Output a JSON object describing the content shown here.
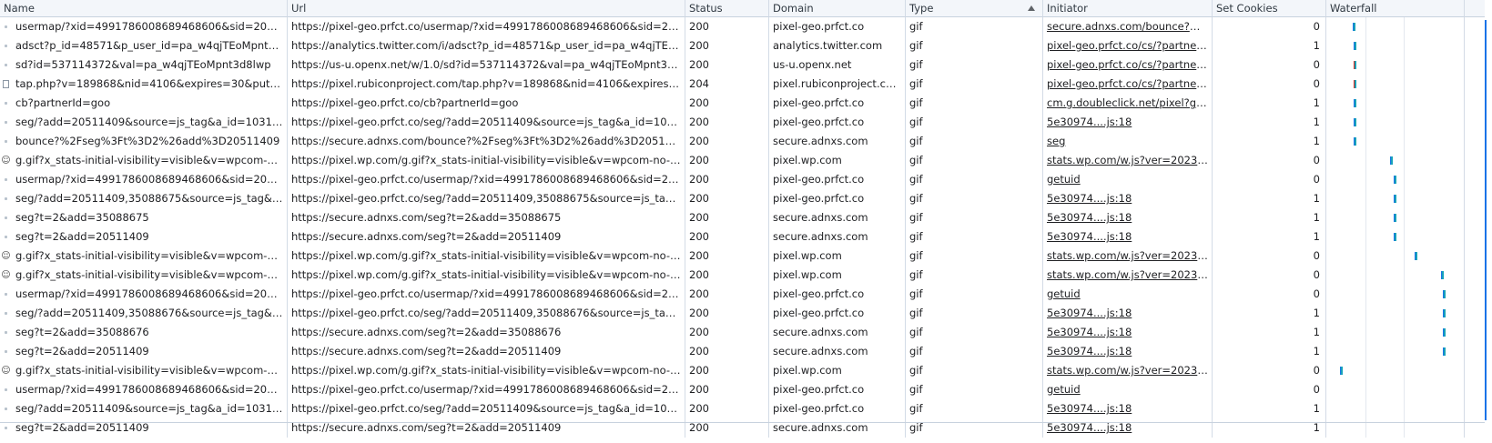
{
  "columns": {
    "name": "Name",
    "url": "Url",
    "status": "Status",
    "domain": "Domain",
    "type": "Type",
    "initiator": "Initiator",
    "set_cookies": "Set Cookies",
    "waterfall": "Waterfall"
  },
  "sort": {
    "column": "type",
    "direction": "ascending"
  },
  "colors": {
    "header_bg": "#f3f6fa",
    "grid_line": "#d3dbe6",
    "bar_wait": "#1a73e8",
    "bar_download": "#17a2b8",
    "bar_blocked": "#d93025"
  },
  "rows": [
    {
      "icon": "dot",
      "name": "usermap/?xid=4991786008689468606&sid=202311|6...",
      "url": "https://pixel-geo.prfct.co/usermap/?xid=4991786008689468606&sid=202311|...",
      "status": "200",
      "domain": "pixel-geo.prfct.co",
      "type": "gif",
      "initiator": "secure.adnxs.com/bounce?%2Fget...",
      "cookies": "0",
      "wf": 0.19
    },
    {
      "icon": "dot",
      "name": "adsct?p_id=48571&p_user_id=pa_w4qjTEoMpnt3d8lwp",
      "url": "https://analytics.twitter.com/i/adsct?p_id=48571&p_user_id=pa_w4qjTEoMpnt...",
      "status": "200",
      "domain": "analytics.twitter.com",
      "type": "gif",
      "initiator": "pixel-geo.prfct.co/cs/?partnerId=t...",
      "cookies": "1",
      "wf": 0.2
    },
    {
      "icon": "dot",
      "name": "sd?id=537114372&val=pa_w4qjTEoMpnt3d8lwp",
      "url": "https://us-u.openx.net/w/1.0/sd?id=537114372&val=pa_w4qjTEoMpnt3d8lwp",
      "status": "200",
      "domain": "us-u.openx.net",
      "type": "gif",
      "initiator": "pixel-geo.prfct.co/cs/?partnerId=o...",
      "cookies": "0",
      "wf": 0.2,
      "multi": true
    },
    {
      "icon": "page",
      "name": "tap.php?v=189868&nid=4106&expires=30&put=pa_...",
      "url": "https://pixel.rubiconproject.com/tap.php?v=189868&nid=4106&expires=30&p...",
      "status": "204",
      "domain": "pixel.rubiconproject.com",
      "type": "gif",
      "initiator": "pixel-geo.prfct.co/cs/?partnerId=r...",
      "cookies": "0",
      "wf": 0.2,
      "multi": true
    },
    {
      "icon": "dot",
      "name": "cb?partnerId=goo",
      "url": "https://pixel-geo.prfct.co/cb?partnerId=goo",
      "status": "200",
      "domain": "pixel-geo.prfct.co",
      "type": "gif",
      "initiator": "cm.g.doubleclick.net/pixel?google...",
      "cookies": "1",
      "wf": 0.2
    },
    {
      "icon": "dot",
      "name": "seg/?add=20511409&source=js_tag&a_id=103156",
      "url": "https://pixel-geo.prfct.co/seg/?add=20511409&source=js_tag&a_id=103156",
      "status": "200",
      "domain": "pixel-geo.prfct.co",
      "type": "gif",
      "initiator": "5e30974....js:18",
      "cookies": "1",
      "wf": 0.2
    },
    {
      "icon": "dot",
      "name": "bounce?%2Fseg%3Ft%3D2%26add%3D20511409",
      "url": "https://secure.adnxs.com/bounce?%2Fseg%3Ft%3D2%26add%3D20511409",
      "status": "200",
      "domain": "secure.adnxs.com",
      "type": "gif",
      "initiator": "seg",
      "cookies": "1",
      "wf": 0.2
    },
    {
      "icon": "face",
      "name": "g.gif?x_stats-initial-visibility=visible&v=wpcom-no-pv...",
      "url": "https://pixel.wp.com/g.gif?x_stats-initial-visibility=visible&v=wpcom-no-pv&ra...",
      "status": "200",
      "domain": "pixel.wp.com",
      "type": "gif",
      "initiator": "stats.wp.com/w.js?ver=202345:1",
      "cookies": "0",
      "wf": 0.46
    },
    {
      "icon": "dot",
      "name": "usermap/?xid=4991786008689468606&sid=202311|6...",
      "url": "https://pixel-geo.prfct.co/usermap/?xid=4991786008689468606&sid=202311|...",
      "status": "200",
      "domain": "pixel-geo.prfct.co",
      "type": "gif",
      "initiator": "getuid",
      "cookies": "0",
      "wf": 0.49
    },
    {
      "icon": "dot",
      "name": "seg/?add=20511409,35088675&source=js_tag&a_id=...",
      "url": "https://pixel-geo.prfct.co/seg/?add=20511409,35088675&source=js_tag&a_id...",
      "status": "200",
      "domain": "pixel-geo.prfct.co",
      "type": "gif",
      "initiator": "5e30974....js:18",
      "cookies": "1",
      "wf": 0.49
    },
    {
      "icon": "dot",
      "name": "seg?t=2&add=35088675",
      "url": "https://secure.adnxs.com/seg?t=2&add=35088675",
      "status": "200",
      "domain": "secure.adnxs.com",
      "type": "gif",
      "initiator": "5e30974....js:18",
      "cookies": "1",
      "wf": 0.49
    },
    {
      "icon": "dot",
      "name": "seg?t=2&add=20511409",
      "url": "https://secure.adnxs.com/seg?t=2&add=20511409",
      "status": "200",
      "domain": "secure.adnxs.com",
      "type": "gif",
      "initiator": "5e30974....js:18",
      "cookies": "1",
      "wf": 0.49
    },
    {
      "icon": "face",
      "name": "g.gif?x_stats-initial-visibility=visible&v=wpcom-no-pv...",
      "url": "https://pixel.wp.com/g.gif?x_stats-initial-visibility=visible&v=wpcom-no-pv&ra...",
      "status": "200",
      "domain": "pixel.wp.com",
      "type": "gif",
      "initiator": "stats.wp.com/w.js?ver=202345:1",
      "cookies": "0",
      "wf": 0.64
    },
    {
      "icon": "face",
      "name": "g.gif?x_stats-initial-visibility=visible&v=wpcom-no-pv...",
      "url": "https://pixel.wp.com/g.gif?x_stats-initial-visibility=visible&v=wpcom-no-pv&ra...",
      "status": "200",
      "domain": "pixel.wp.com",
      "type": "gif",
      "initiator": "stats.wp.com/w.js?ver=202345:1",
      "cookies": "0",
      "wf": 0.83
    },
    {
      "icon": "dot",
      "name": "usermap/?xid=4991786008689468606&sid=202311|6...",
      "url": "https://pixel-geo.prfct.co/usermap/?xid=4991786008689468606&sid=202311|...",
      "status": "200",
      "domain": "pixel-geo.prfct.co",
      "type": "gif",
      "initiator": "getuid",
      "cookies": "0",
      "wf": 0.84
    },
    {
      "icon": "dot",
      "name": "seg/?add=20511409,35088676&source=js_tag&a_id=...",
      "url": "https://pixel-geo.prfct.co/seg/?add=20511409,35088676&source=js_tag&a_id...",
      "status": "200",
      "domain": "pixel-geo.prfct.co",
      "type": "gif",
      "initiator": "5e30974....js:18",
      "cookies": "1",
      "wf": 0.84
    },
    {
      "icon": "dot",
      "name": "seg?t=2&add=35088676",
      "url": "https://secure.adnxs.com/seg?t=2&add=35088676",
      "status": "200",
      "domain": "secure.adnxs.com",
      "type": "gif",
      "initiator": "5e30974....js:18",
      "cookies": "1",
      "wf": 0.84
    },
    {
      "icon": "dot",
      "name": "seg?t=2&add=20511409",
      "url": "https://secure.adnxs.com/seg?t=2&add=20511409",
      "status": "200",
      "domain": "secure.adnxs.com",
      "type": "gif",
      "initiator": "5e30974....js:18",
      "cookies": "1",
      "wf": 0.84
    },
    {
      "icon": "face",
      "name": "g.gif?x_stats-initial-visibility=visible&v=wpcom-no-pv...",
      "url": "https://pixel.wp.com/g.gif?x_stats-initial-visibility=visible&v=wpcom-no-pv&ra...",
      "status": "200",
      "domain": "pixel.wp.com",
      "type": "gif",
      "initiator": "stats.wp.com/w.js?ver=202345:1",
      "cookies": "0",
      "wf": 0.1
    },
    {
      "icon": "dot",
      "name": "usermap/?xid=4991786008689468606&sid=202311|6...",
      "url": "https://pixel-geo.prfct.co/usermap/?xid=4991786008689468606&sid=202311|...",
      "status": "200",
      "domain": "pixel-geo.prfct.co",
      "type": "gif",
      "initiator": "getuid",
      "cookies": "0",
      "wf": null
    },
    {
      "icon": "dot",
      "name": "seg/?add=20511409&source=js_tag&a_id=103156",
      "url": "https://pixel-geo.prfct.co/seg/?add=20511409&source=js_tag&a_id=103156",
      "status": "200",
      "domain": "pixel-geo.prfct.co",
      "type": "gif",
      "initiator": "5e30974....js:18",
      "cookies": "1",
      "wf": null
    },
    {
      "icon": "dot",
      "name": "seg?t=2&add=20511409",
      "url": "https://secure.adnxs.com/seg?t=2&add=20511409",
      "status": "200",
      "domain": "secure.adnxs.com",
      "type": "gif",
      "initiator": "5e30974....js:18",
      "cookies": "1",
      "wf": null
    }
  ]
}
